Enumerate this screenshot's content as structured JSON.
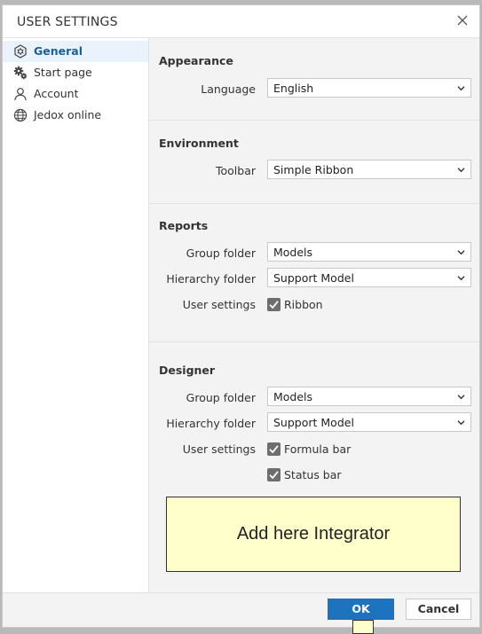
{
  "dialog": {
    "title": "USER SETTINGS"
  },
  "sidebar": {
    "items": [
      {
        "label": "General",
        "icon": "hexagon-gear-icon",
        "active": true
      },
      {
        "label": "Start page",
        "icon": "gears-icon",
        "active": false
      },
      {
        "label": "Account",
        "icon": "user-icon",
        "active": false
      },
      {
        "label": "Jedox online",
        "icon": "globe-icon",
        "active": false
      }
    ]
  },
  "appearance": {
    "title": "Appearance",
    "language_label": "Language",
    "language_value": "English"
  },
  "environment": {
    "title": "Environment",
    "toolbar_label": "Toolbar",
    "toolbar_value": "Simple Ribbon"
  },
  "reports": {
    "title": "Reports",
    "group_folder_label": "Group folder",
    "group_folder_value": "Models",
    "hierarchy_folder_label": "Hierarchy folder",
    "hierarchy_folder_value": "Support Model",
    "user_settings_label": "User settings",
    "ribbon_label": "Ribbon",
    "ribbon_checked": true
  },
  "designer": {
    "title": "Designer",
    "group_folder_label": "Group folder",
    "group_folder_value": "Models",
    "hierarchy_folder_label": "Hierarchy folder",
    "hierarchy_folder_value": "Support Model",
    "user_settings_label": "User settings",
    "formula_bar_label": "Formula bar",
    "formula_bar_checked": true,
    "status_bar_label": "Status bar",
    "status_bar_checked": true
  },
  "integrator_note": "Add here Integrator",
  "footer": {
    "ok_label": "OK",
    "cancel_label": "Cancel"
  },
  "colors": {
    "accent": "#1e73be",
    "note_bg": "#ffffcc",
    "active_nav": "#1a5e9e"
  }
}
